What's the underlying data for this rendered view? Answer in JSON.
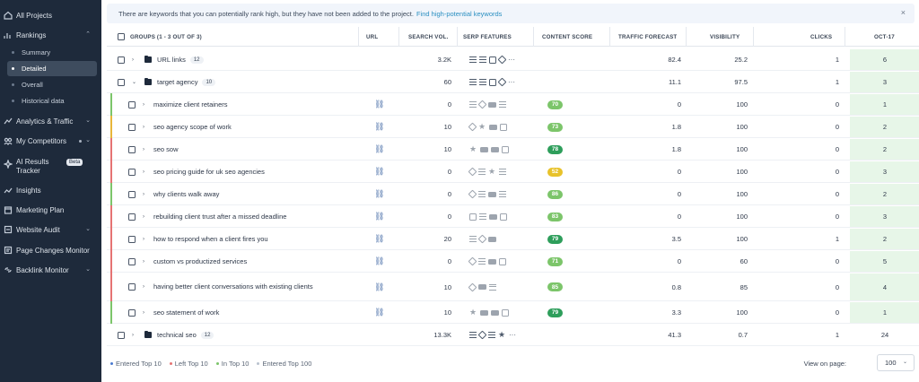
{
  "sidebar": {
    "items": [
      {
        "label": "All Projects",
        "icon": "home-icon"
      },
      {
        "label": "Rankings",
        "icon": "bar-chart-icon",
        "expanded": true
      },
      {
        "label": "Analytics & Traffic",
        "icon": "trend-icon"
      },
      {
        "label": "My Competitors",
        "icon": "competitors-icon"
      },
      {
        "label": "AI Results Tracker",
        "icon": "ai-icon",
        "badge": "Beta"
      },
      {
        "label": "Insights",
        "icon": "insights-icon"
      },
      {
        "label": "Marketing Plan",
        "icon": "calendar-icon"
      },
      {
        "label": "Website Audit",
        "icon": "audit-icon"
      },
      {
        "label": "Page Changes Monitor",
        "icon": "monitor-icon"
      },
      {
        "label": "Backlink Monitor",
        "icon": "link-icon"
      }
    ],
    "rankings_sub": [
      "Summary",
      "Detailed",
      "Overall",
      "Historical data"
    ],
    "active_sub": "Detailed"
  },
  "banner": {
    "text": "There are keywords that you can potentially rank high, but they have not been added to the project.",
    "link": "Find high-potential keywords",
    "close": "×"
  },
  "table": {
    "headers": {
      "groups": "GROUPS (1 - 3 OUT OF 3)",
      "url": "URL",
      "search_vol": "SEARCH VOL.",
      "serp": "SERP FEATURES",
      "content_score": "CONTENT SCORE",
      "traffic": "TRAFFIC FORECAST",
      "visibility": "VISIBILITY",
      "clicks": "CLICKS",
      "date": "OCT-17"
    },
    "rows": [
      {
        "type": "group",
        "name": "URL links",
        "count": "12",
        "vol": "3.2K",
        "traffic": "82.4",
        "vis": "25.2",
        "clicks": "1",
        "pos": "6",
        "serp": [
          "list",
          "list",
          "img",
          "dia",
          "dots"
        ]
      },
      {
        "type": "group",
        "name": "target agency",
        "count": "10",
        "vol": "60",
        "traffic": "11.1",
        "vis": "97.5",
        "clicks": "1",
        "pos": "3",
        "open": true,
        "serp": [
          "list",
          "list",
          "img",
          "dia",
          "dots"
        ]
      },
      {
        "type": "kw",
        "name": "maximize client retainers",
        "vol": "0",
        "score": "70",
        "scolor": "#7cc56a",
        "traffic": "0",
        "vis": "100",
        "clicks": "0",
        "pos": "1",
        "bar": "#7cc56a",
        "serp": [
          "list",
          "dia",
          "vid",
          "list"
        ]
      },
      {
        "type": "kw",
        "name": "seo agency scope of work",
        "vol": "10",
        "score": "73",
        "scolor": "#7cc56a",
        "traffic": "1.8",
        "vis": "100",
        "clicks": "0",
        "pos": "2",
        "bar": "#e8b63a",
        "serp": [
          "dia",
          "star",
          "vid",
          "img"
        ]
      },
      {
        "type": "kw",
        "name": "seo sow",
        "vol": "10",
        "score": "78",
        "scolor": "#2e9e5b",
        "traffic": "1.8",
        "vis": "100",
        "clicks": "0",
        "pos": "2",
        "bar": "#e57373",
        "serp": [
          "star",
          "vid",
          "vid",
          "img"
        ]
      },
      {
        "type": "kw",
        "name": "seo pricing guide for uk seo agencies",
        "vol": "0",
        "score": "52",
        "scolor": "#e8c22a",
        "traffic": "0",
        "vis": "100",
        "clicks": "0",
        "pos": "3",
        "bar": "#e57373",
        "serp": [
          "dia",
          "list",
          "star",
          "list"
        ]
      },
      {
        "type": "kw",
        "name": "why clients walk away",
        "vol": "0",
        "score": "86",
        "scolor": "#7cc56a",
        "traffic": "0",
        "vis": "100",
        "clicks": "0",
        "pos": "2",
        "bar": "#7cc56a",
        "serp": [
          "dia",
          "list",
          "vid",
          "list"
        ]
      },
      {
        "type": "kw",
        "name": "rebuilding client trust after a missed deadline",
        "vol": "0",
        "score": "83",
        "scolor": "#7cc56a",
        "traffic": "0",
        "vis": "100",
        "clicks": "0",
        "pos": "3",
        "bar": "#e57373",
        "serp": [
          "img",
          "list",
          "vid",
          "img"
        ]
      },
      {
        "type": "kw",
        "name": "how to respond when a client fires you",
        "vol": "20",
        "score": "79",
        "scolor": "#2e9e5b",
        "traffic": "3.5",
        "vis": "100",
        "clicks": "1",
        "pos": "2",
        "bar": "#e57373",
        "serp": [
          "list",
          "dia",
          "vid"
        ]
      },
      {
        "type": "kw",
        "name": "custom vs productized services",
        "vol": "0",
        "score": "71",
        "scolor": "#7cc56a",
        "traffic": "0",
        "vis": "60",
        "clicks": "0",
        "pos": "5",
        "bar": "#e57373",
        "serp": [
          "dia",
          "list",
          "vid",
          "img"
        ]
      },
      {
        "type": "kw",
        "name": "having better client conversations with existing clients",
        "vol": "10",
        "score": "85",
        "scolor": "#7cc56a",
        "traffic": "0.8",
        "vis": "85",
        "clicks": "0",
        "pos": "4",
        "bar": "#e57373",
        "tall": true,
        "serp": [
          "dia",
          "vid",
          "list"
        ]
      },
      {
        "type": "kw",
        "name": "seo statement of work",
        "vol": "10",
        "score": "79",
        "scolor": "#2e9e5b",
        "traffic": "3.3",
        "vis": "100",
        "clicks": "0",
        "pos": "1",
        "bar": "#7cc56a",
        "serp": [
          "star",
          "vid",
          "vid",
          "img"
        ]
      },
      {
        "type": "group",
        "name": "technical seo",
        "count": "12",
        "vol": "13.3K",
        "traffic": "41.3",
        "vis": "0.7",
        "clicks": "1",
        "pos": "24",
        "plainpos": true,
        "serp": [
          "list",
          "dia",
          "list",
          "star",
          "dots"
        ]
      }
    ]
  },
  "footer": {
    "legend": [
      {
        "label": "Entered Top 10",
        "color": "#4a7bd0"
      },
      {
        "label": "Left Top 10",
        "color": "#e57373"
      },
      {
        "label": "In Top 10",
        "color": "#7cc56a"
      },
      {
        "label": "Entered Top 100",
        "color": "#b9c2ce"
      }
    ],
    "view_label": "View on page:",
    "view_value": "100"
  }
}
